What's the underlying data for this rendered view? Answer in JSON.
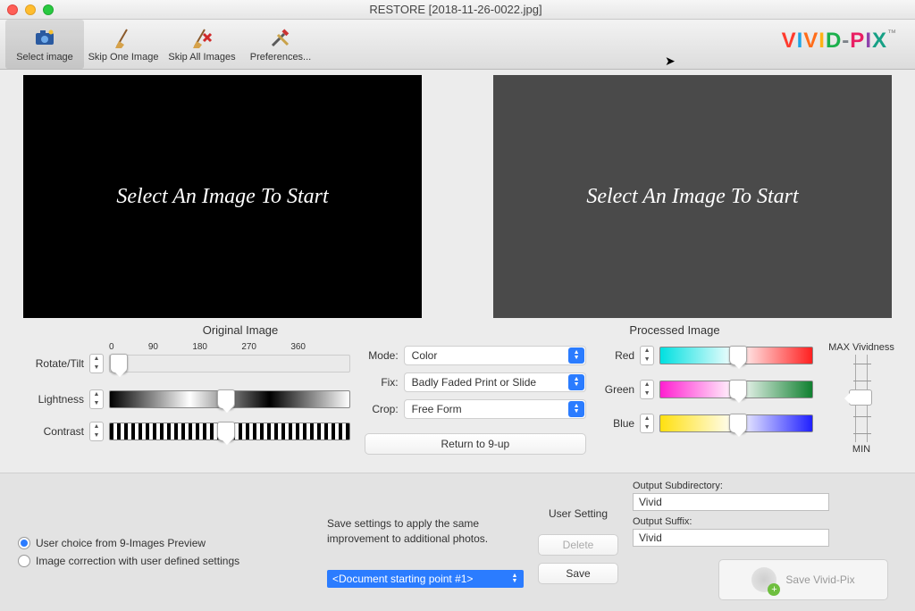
{
  "window": {
    "title": "RESTORE [2018-11-26-0022.jpg]"
  },
  "toolbar": {
    "select_image": "Select image",
    "skip_one": "Skip One Image",
    "skip_all": "Skip All Images",
    "preferences": "Preferences...",
    "logo_text": "VIVID-PIX"
  },
  "preview": {
    "left_placeholder": "Select An Image To Start",
    "right_placeholder": "Select An Image To Start",
    "original_label": "Original Image",
    "processed_label": "Processed Image"
  },
  "left_controls": {
    "rotate_label": "Rotate/Tilt",
    "lightness_label": "Lightness",
    "contrast_label": "Contrast",
    "ticks": [
      "0",
      "90",
      "180",
      "270",
      "360"
    ]
  },
  "mid_controls": {
    "mode_label": "Mode:",
    "mode_value": "Color",
    "fix_label": "Fix:",
    "fix_value": "Badly Faded Print or Slide",
    "crop_label": "Crop:",
    "crop_value": "Free Form",
    "return_btn": "Return to 9-up"
  },
  "right_controls": {
    "red_label": "Red",
    "green_label": "Green",
    "blue_label": "Blue",
    "max_label": "MAX Vividness",
    "min_label": "MIN"
  },
  "bottom": {
    "radio1": "User choice from 9-Images Preview",
    "radio2": "Image correction with user defined settings",
    "save_desc": "Save settings to apply the same improvement to additional photos.",
    "starting_point": "<Document starting point #1>",
    "user_setting_hdr": "User Setting",
    "delete_btn": "Delete",
    "save_btn": "Save",
    "out_subdir_lbl": "Output Subdirectory:",
    "out_subdir_val": "Vivid",
    "out_suffix_lbl": "Output Suffix:",
    "out_suffix_val": "Vivid",
    "save_main": "Save Vivid-Pix"
  }
}
